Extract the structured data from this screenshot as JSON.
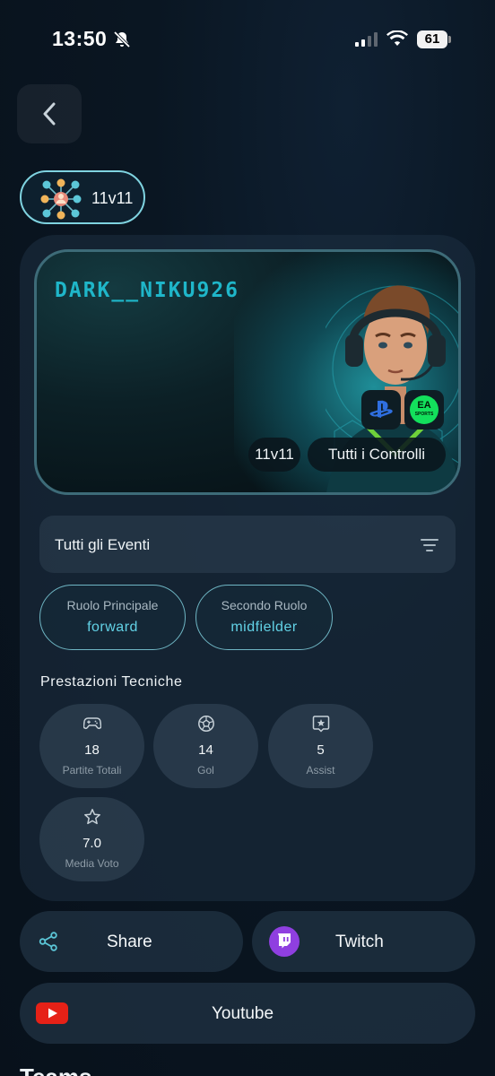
{
  "status_bar": {
    "time": "13:50",
    "battery": "61"
  },
  "header": {
    "mode_badge": "11v11"
  },
  "player_card": {
    "name": "DARK__NIKU926",
    "platforms": [
      "playstation-icon",
      "ea-sports-icon"
    ],
    "ea_text": "EA",
    "ea_subtext": "SPORTS",
    "chips": {
      "mode": "11v11",
      "controls": "Tutti i Controlli"
    }
  },
  "events_filter": {
    "label": "Tutti gli Eventi"
  },
  "roles": {
    "primary": {
      "title": "Ruolo Principale",
      "value": "forward"
    },
    "secondary": {
      "title": "Secondo Ruolo",
      "value": "midfielder"
    }
  },
  "stats": {
    "title": "Prestazioni Tecniche",
    "items": [
      {
        "icon": "gamepad-icon",
        "value": "18",
        "label": "Partite Totali"
      },
      {
        "icon": "soccer-ball-icon",
        "value": "14",
        "label": "Gol"
      },
      {
        "icon": "assist-icon",
        "value": "5",
        "label": "Assist"
      },
      {
        "icon": "star-icon",
        "value": "7.0",
        "label": "Media Voto"
      }
    ]
  },
  "actions": {
    "share": "Share",
    "twitch": "Twitch",
    "youtube": "Youtube"
  },
  "teams": {
    "heading": "Teams"
  },
  "colors": {
    "accent": "#62d2e6",
    "twitch": "#8f3fe0",
    "youtube": "#e62117",
    "ea_green": "#13e05c"
  }
}
